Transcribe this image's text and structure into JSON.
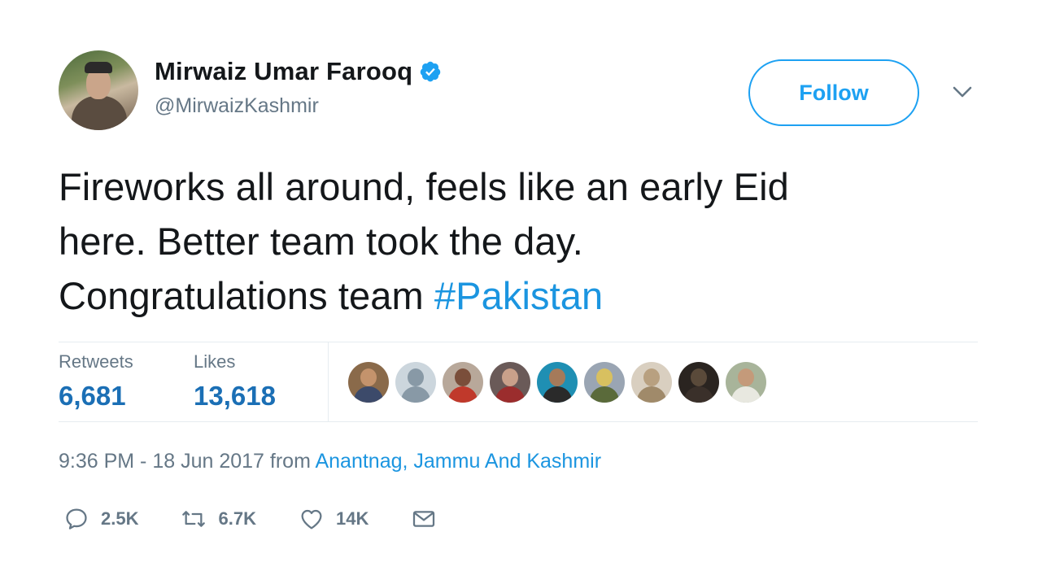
{
  "author": {
    "display_name": "Mirwaiz Umar Farooq",
    "handle": "@MirwaizKashmir",
    "verified": true
  },
  "follow_button": {
    "label": "Follow"
  },
  "tweet": {
    "lines": [
      "Fireworks all around, feels like an early Eid",
      "here. Better team took the day.",
      "Congratulations team "
    ],
    "hashtag": "#Pakistan"
  },
  "stats": {
    "retweets_label": "Retweets",
    "retweets_value": "6,681",
    "likes_label": "Likes",
    "likes_value": "13,618"
  },
  "meta": {
    "timestamp": "9:36 PM - 18 Jun 2017",
    "from": " from ",
    "location": "Anantnag, Jammu And Kashmir"
  },
  "actions": {
    "reply_count": "2.5K",
    "retweet_count": "6.7K",
    "like_count": "14K"
  },
  "icons": [
    "verified-icon",
    "chevron-down-icon",
    "reply-icon",
    "retweet-icon",
    "heart-icon",
    "mail-icon"
  ],
  "colors": {
    "accent": "#1da1f2",
    "link": "#1b95e0",
    "stat_value": "#1b6fb5",
    "muted": "#657786",
    "text": "#14171a"
  }
}
